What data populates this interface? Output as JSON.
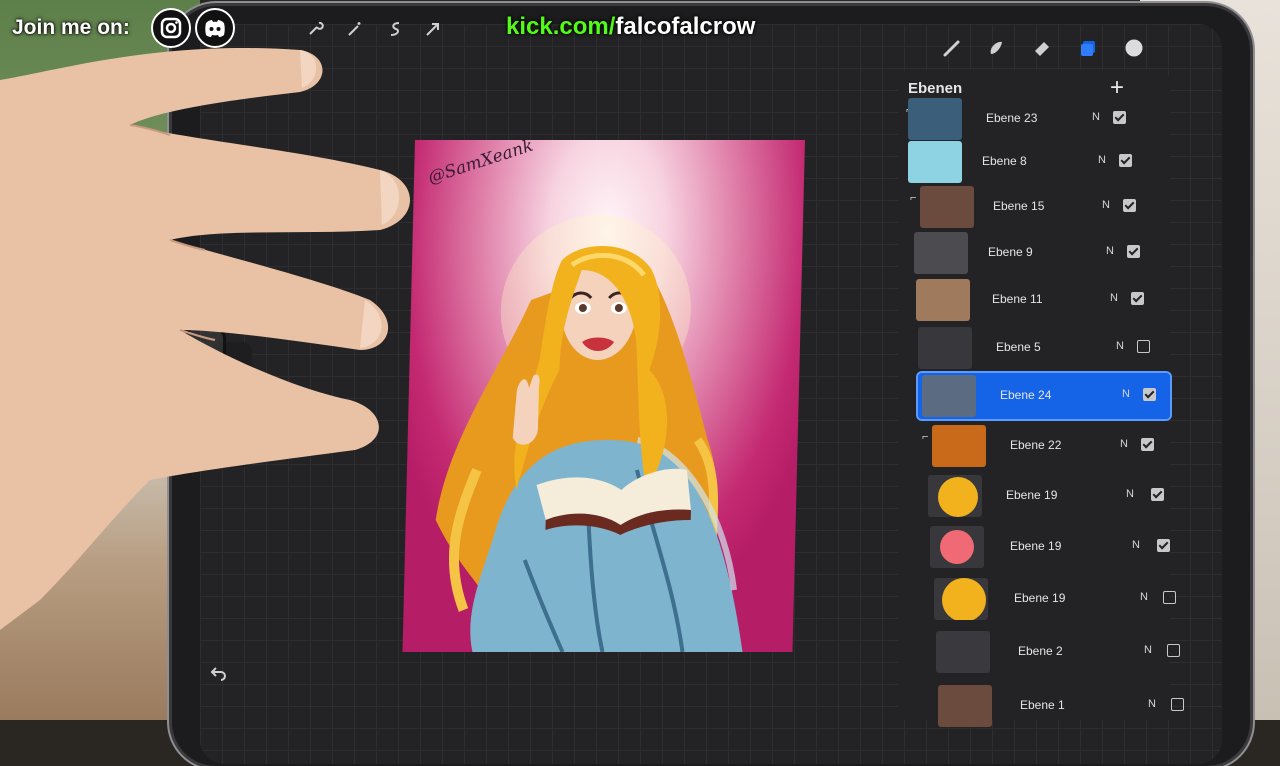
{
  "overlay": {
    "join_text": "Join me on:",
    "kick_domain": "kick.com/",
    "kick_user": "falcofalcrow",
    "icons": [
      "instagram-icon",
      "discord-icon"
    ],
    "kick_color": "#53fc18"
  },
  "toolbar": {
    "left_icons": [
      "wrench-icon",
      "magic-wand-icon",
      "selection-icon",
      "transform-arrow-icon"
    ],
    "right_icons": [
      "brush-icon",
      "smudge-icon",
      "eraser-icon",
      "layers-icon",
      "color-icon"
    ]
  },
  "artwork": {
    "signature": "@SamXeank"
  },
  "layers_panel": {
    "title": "Ebenen",
    "add_icon": "plus-icon",
    "active_color": "#1564e8",
    "layers": [
      {
        "name": "Ebene 23",
        "mode": "N",
        "visible": true
      },
      {
        "name": "Ebene 8",
        "mode": "N",
        "visible": true
      },
      {
        "name": "Ebene 15",
        "mode": "N",
        "visible": true
      },
      {
        "name": "Ebene 9",
        "mode": "N",
        "visible": true
      },
      {
        "name": "Ebene 11",
        "mode": "N",
        "visible": true
      },
      {
        "name": "Ebene 5",
        "mode": "N",
        "visible": false
      },
      {
        "name": "Ebene 24",
        "mode": "N",
        "visible": true
      },
      {
        "name": "Ebene 22",
        "mode": "N",
        "visible": true
      },
      {
        "name": "Ebene 19",
        "mode": "N",
        "visible": true
      },
      {
        "name": "Ebene 19",
        "mode": "N",
        "visible": true
      },
      {
        "name": "Ebene 19",
        "mode": "N",
        "visible": false
      },
      {
        "name": "Ebene 2",
        "mode": "N",
        "visible": false
      },
      {
        "name": "Ebene 1",
        "mode": "N",
        "visible": false
      }
    ]
  }
}
